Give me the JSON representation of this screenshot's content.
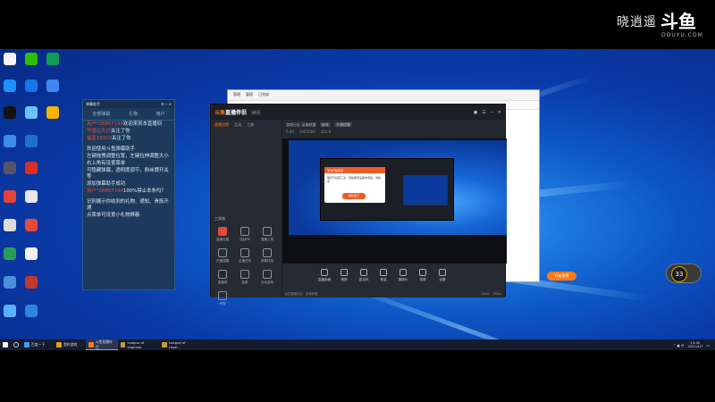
{
  "watermark": {
    "name": "晓逍遥",
    "brand": "斗鱼",
    "domain": "DOUYU.COM"
  },
  "chat": {
    "title": "弹幕助手",
    "tabs": [
      "全部弹幕",
      "礼物",
      "用户"
    ],
    "lines": [
      {
        "user": "用户*28857194",
        "text": "欢迎来到本直播间"
      },
      {
        "user": "华强北大仔",
        "text": "关注了你"
      },
      {
        "user": "福星10310",
        "text": "关注了你"
      },
      {
        "user": "",
        "text": "欢迎使用斗鱼弹幕助手"
      },
      {
        "user": "",
        "text": "左键拖拽调整位置，左键拉伸调整大小"
      },
      {
        "user": "",
        "text": "右上角有设置菜单"
      },
      {
        "user": "",
        "text": "可隐藏弹幕，透明度调节，粉丝牌开关等"
      },
      {
        "user": "",
        "text": "添加弹幕助手成功"
      },
      {
        "user": "用户*28857194",
        "text": "100%禁止本条吗？"
      },
      {
        "user": "",
        "text": "识别展示你收到的礼物、通知、贵族开通"
      },
      {
        "user": "",
        "text": "点菜单可设置小礼物屏蔽"
      }
    ]
  },
  "explorer": {
    "tabs": [
      "管理",
      "管理",
      "已完成"
    ]
  },
  "app": {
    "logo_a": "斗鱼",
    "logo_b": "直播伴侣",
    "version": "v6.0",
    "left_tabs": [
      "直播设置",
      "互动",
      "工具"
    ],
    "toolbox_label": "工具箱",
    "tools": [
      "直播设置",
      "连线PK",
      "直播工具",
      "开播提醒",
      "主播任务",
      "观看特效",
      "直播间",
      "抽奖",
      "互动游戏",
      "房管"
    ],
    "header": {
      "title": "游戏分区-英雄联盟",
      "btn1": "修改",
      "btn2": "开播提醒",
      "stat1": "0.84",
      "stat2": "1/4/5000",
      "stat3": "452.0"
    },
    "bottom": [
      "直播画面",
      "美颜",
      "麦克风",
      "音量",
      "摄像头",
      "录屏",
      "设置"
    ],
    "go_live": "开始直播",
    "status_left": "当前直播分区：英雄联盟",
    "stat_net": "0kb/s",
    "stat_fps": "30fps",
    "dialog": {
      "title": "无法开始直播",
      "body": "每天可设置三次，但如果有设备未连接，请检查",
      "button": "我知道了"
    }
  },
  "badge": {
    "value": "33"
  },
  "taskbar": {
    "items": [
      "百度一下",
      "我的游戏",
      "斗鱼直播伴侣",
      "League of Legends",
      "League of Lege..."
    ],
    "time": "13:40",
    "date": "2021/4/7"
  },
  "colors": {
    "accent": "#ff7a18",
    "chat_user": "#e24b3c",
    "desktop": "#0c56c4"
  }
}
